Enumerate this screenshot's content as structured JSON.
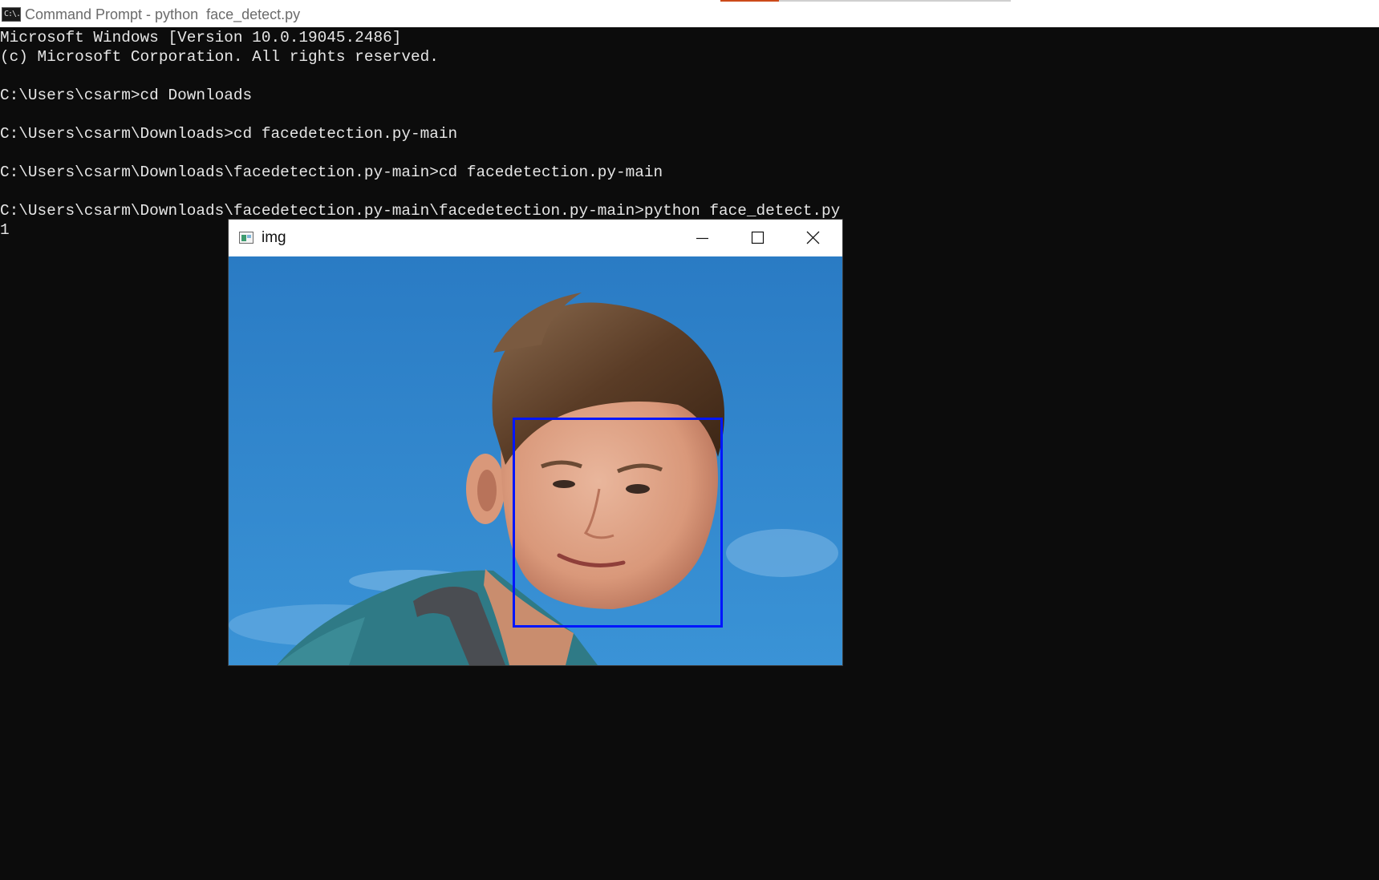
{
  "window": {
    "title": "Command Prompt - python  face_detect.py",
    "icon_label": "C:\\."
  },
  "console": {
    "lines": [
      "Microsoft Windows [Version 10.0.19045.2486]",
      "(c) Microsoft Corporation. All rights reserved.",
      "",
      "C:\\Users\\csarm>cd Downloads",
      "",
      "C:\\Users\\csarm\\Downloads>cd facedetection.py-main",
      "",
      "C:\\Users\\csarm\\Downloads\\facedetection.py-main>cd facedetection.py-main",
      "",
      "C:\\Users\\csarm\\Downloads\\facedetection.py-main\\facedetection.py-main>python face_detect.py",
      "1"
    ]
  },
  "img_window": {
    "title": "img",
    "icons": [
      "image-app-icon",
      "minimize-icon",
      "maximize-icon",
      "close-icon"
    ],
    "detection_box_color": "#0016ff"
  },
  "colors": {
    "console_bg": "#0c0c0c",
    "console_text": "#e6e6e6",
    "taskbar_accent": "#cc4a1a"
  }
}
